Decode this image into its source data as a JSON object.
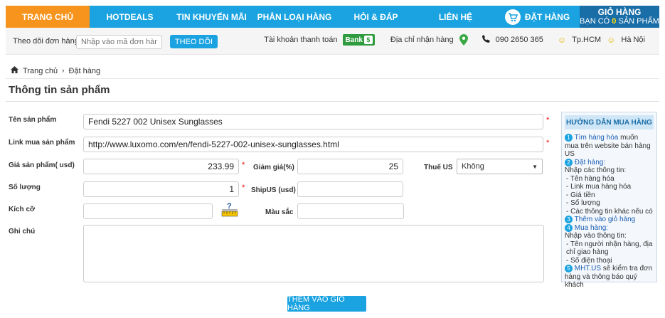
{
  "nav": {
    "items": [
      "TRANG CHỦ",
      "HOTDEALS",
      "TIN KHUYẾN MÃI",
      "PHÂN LOẠI HÀNG",
      "HỎI & ĐÁP",
      "LIÊN HỆ"
    ],
    "order": "ĐẶT HÀNG",
    "cart_title": "GIỎ HÀNG",
    "cart_prefix": "Bạn có",
    "cart_count": "0",
    "cart_suffix": "sản phẩm"
  },
  "track": {
    "label": "Theo dõi đơn hàng",
    "placeholder": "Nhập vào mã đơn hàng.",
    "button": "THEO DÕI",
    "account": "Tài khoản thanh toán",
    "bank": "Bank",
    "address": "Địa chỉ nhận hàng",
    "phone": "090 2650 365",
    "city1": "Tp.HCM",
    "city2": "Hà Nội"
  },
  "breadcrumb": {
    "home": "Trang chủ",
    "current": "Đặt hàng"
  },
  "page_title": "Thông tin sản phẩm",
  "form": {
    "name_label": "Tên sản phẩm",
    "name_value": "Fendi 5227 002 Unisex Sunglasses",
    "link_label": "Link mua sản phẩm",
    "link_value": "http://www.luxomo.com/en/fendi-5227-002-unisex-sunglasses.html",
    "price_label": "Giá sản phẩm( usd)",
    "price_value": "233.99",
    "discount_label": "Giảm giá(%)",
    "discount_value": "25",
    "tax_label": "Thuế US",
    "tax_value": "Không",
    "qty_label": "Số lượng",
    "qty_value": "1",
    "ship_label": "ShipUS (usd)",
    "ship_value": "",
    "size_label": "Kích cỡ",
    "size_value": "",
    "color_label": "Màu sắc",
    "color_value": "",
    "note_label": "Ghi chú",
    "add_button": "THÊM VÀO GIỎ HÀNG"
  },
  "guide": {
    "title": "HƯỚNG DẪN MUA HÀNG",
    "s1_link": "Tìm hàng hóa",
    "s1_text": "muốn mua trên website bán hàng US",
    "s2_link": "Đặt hàng:",
    "s2_text": "Nhập các thông tin:",
    "s2_items": [
      "- Tên hàng hóa",
      "- Link mua hàng hóa",
      "- Giá tiền",
      "- Số lượng",
      "- Các thông tin khác nếu có"
    ],
    "s3_link": "Thêm vào giỏ hàng",
    "s4_link": "Mua hàng:",
    "s4_text": "Nhập vào thông tin:",
    "s4_items": [
      "- Tên người nhận hàng, địa chỉ giao hàng",
      "- Số điện thoại"
    ],
    "s5_link": "MHT.US",
    "s5_text": "sẽ kiểm tra đơn hàng và thông báo quý khách"
  }
}
